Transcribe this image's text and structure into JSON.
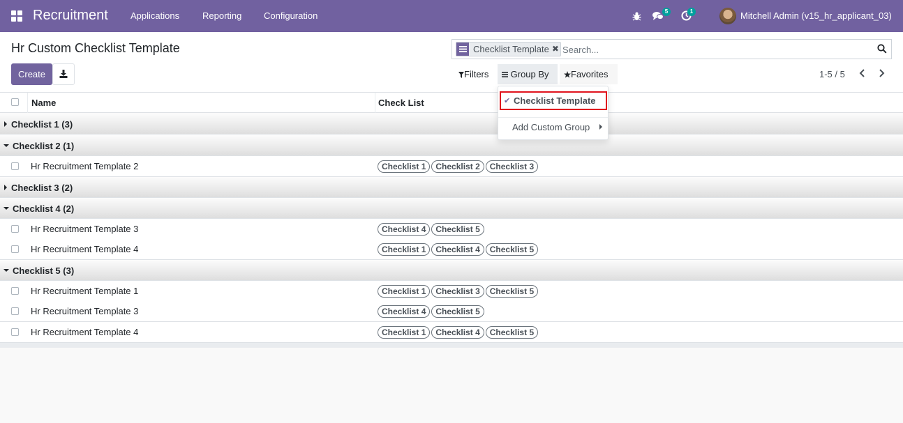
{
  "navbar": {
    "app_name": "Recruitment",
    "menu": [
      "Applications",
      "Reporting",
      "Configuration"
    ],
    "messages_count": "5",
    "activities_count": "1",
    "user_name": "Mitchell Admin (v15_hr_applicant_03)"
  },
  "control_panel": {
    "title": "Hr Custom Checklist Template",
    "create_label": "Create",
    "search": {
      "facet_label": "Checklist Template",
      "placeholder": "Search..."
    },
    "filters_label": "Filters",
    "group_by_label": "Group By",
    "favorites_label": "Favorites",
    "pager": "1-5 / 5"
  },
  "dropdown": {
    "selected_item": "Checklist Template",
    "custom_group_label": "Add Custom Group"
  },
  "list": {
    "columns": [
      "Name",
      "Check List"
    ],
    "groups": [
      {
        "label": "Checklist 1 (3)",
        "expanded": false,
        "rows": []
      },
      {
        "label": "Checklist 2 (1)",
        "expanded": true,
        "rows": [
          {
            "name": "Hr Recruitment Template 2",
            "tags": [
              "Checklist 1",
              "Checklist 2",
              "Checklist 3"
            ]
          }
        ]
      },
      {
        "label": "Checklist 3 (2)",
        "expanded": false,
        "rows": []
      },
      {
        "label": "Checklist 4 (2)",
        "expanded": true,
        "rows": [
          {
            "name": "Hr Recruitment Template 3",
            "tags": [
              "Checklist 4",
              "Checklist 5"
            ]
          },
          {
            "name": "Hr Recruitment Template 4",
            "tags": [
              "Checklist 1",
              "Checklist 4",
              "Checklist 5"
            ]
          }
        ]
      },
      {
        "label": "Checklist 5 (3)",
        "expanded": true,
        "rows": [
          {
            "name": "Hr Recruitment Template 1",
            "tags": [
              "Checklist 1",
              "Checklist 3",
              "Checklist 5"
            ]
          },
          {
            "name": "Hr Recruitment Template 3",
            "tags": [
              "Checklist 4",
              "Checklist 5"
            ]
          },
          {
            "name": "Hr Recruitment Template 4",
            "tags": [
              "Checklist 1",
              "Checklist 4",
              "Checklist 5"
            ]
          }
        ]
      }
    ]
  },
  "colors": {
    "navbar": "#7161a0",
    "primary": "#71639e",
    "highlight_border": "#e0141e",
    "badge": "#00a09d"
  }
}
